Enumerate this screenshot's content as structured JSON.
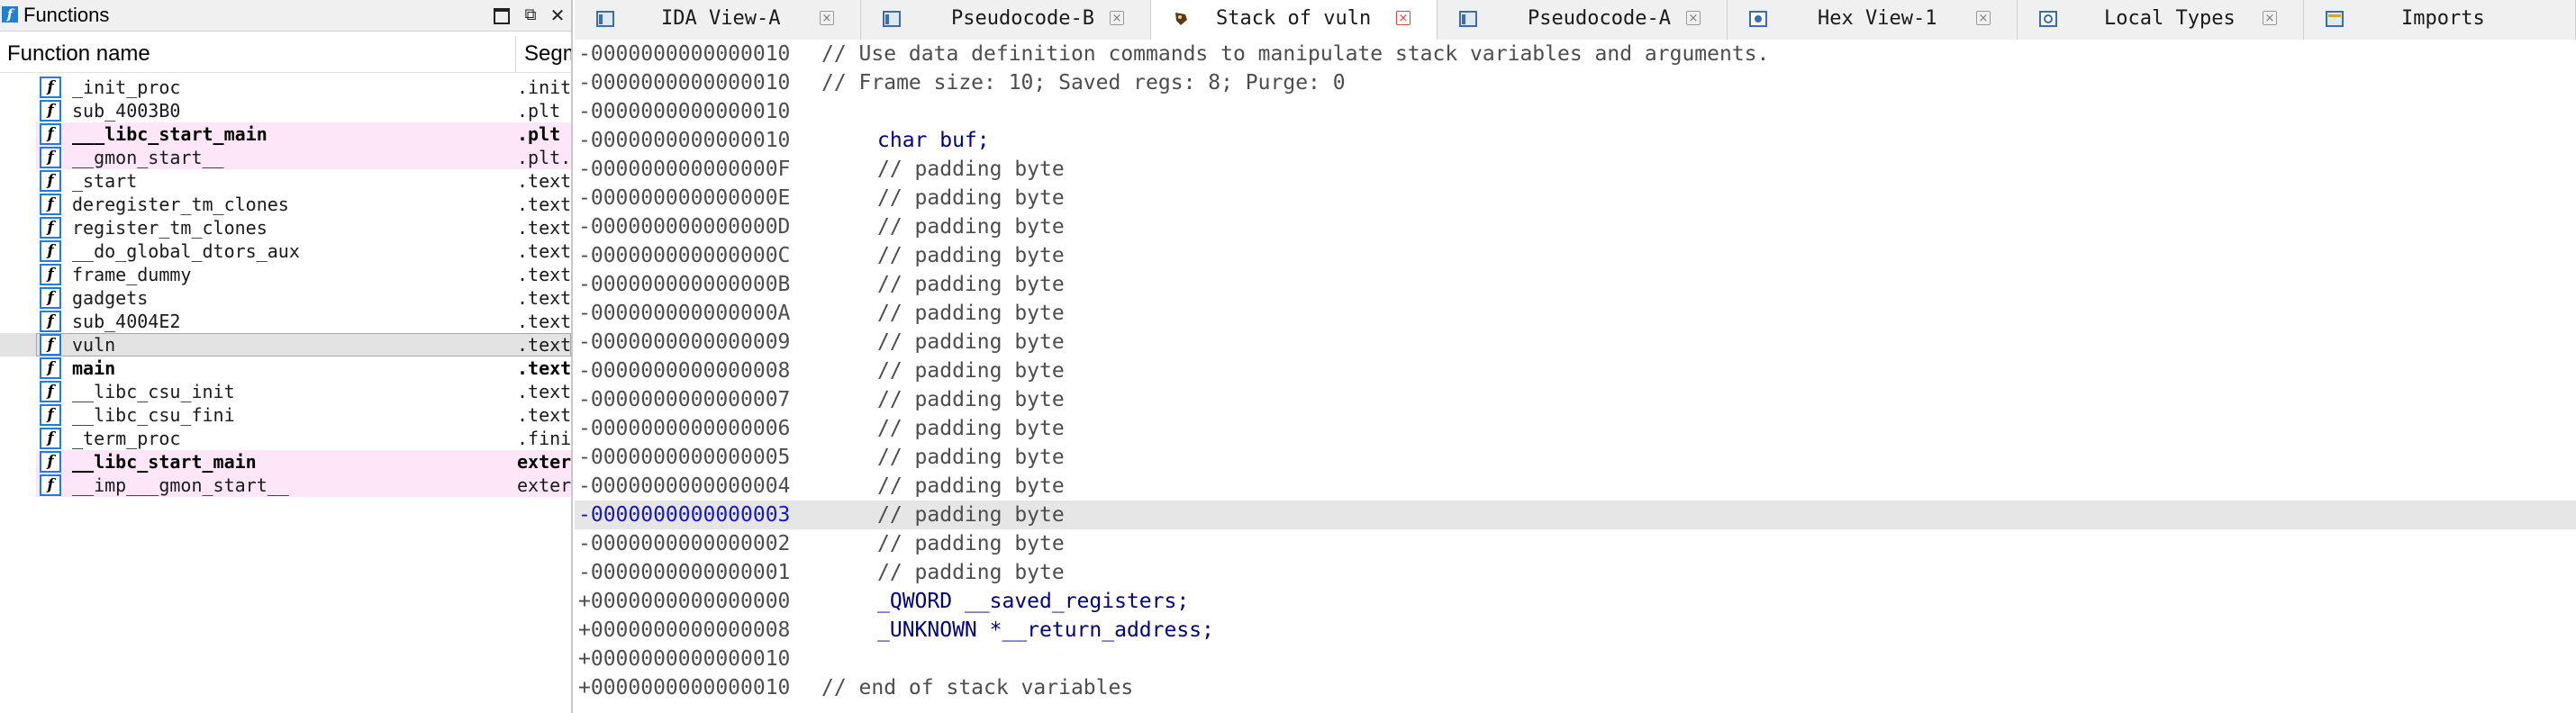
{
  "functions_panel": {
    "title": "Functions",
    "buttons": {
      "maximize": "□",
      "restore": "⧉",
      "close": "✕"
    },
    "columns": {
      "name": "Function name",
      "segment": "Segment"
    },
    "functions": [
      {
        "name": "_init_proc",
        "segment": ".init",
        "style": "normal"
      },
      {
        "name": "sub_4003B0",
        "segment": ".plt",
        "style": "normal"
      },
      {
        "name": "___libc_start_main",
        "segment": ".plt",
        "style": "pink-bold"
      },
      {
        "name": "__gmon_start__",
        "segment": ".plt.got",
        "style": "pink"
      },
      {
        "name": "_start",
        "segment": ".text",
        "style": "normal"
      },
      {
        "name": "deregister_tm_clones",
        "segment": ".text",
        "style": "normal"
      },
      {
        "name": "register_tm_clones",
        "segment": ".text",
        "style": "normal"
      },
      {
        "name": "__do_global_dtors_aux",
        "segment": ".text",
        "style": "normal"
      },
      {
        "name": "frame_dummy",
        "segment": ".text",
        "style": "normal"
      },
      {
        "name": "gadgets",
        "segment": ".text",
        "style": "normal"
      },
      {
        "name": "sub_4004E2",
        "segment": ".text",
        "style": "normal"
      },
      {
        "name": "vuln",
        "segment": ".text",
        "style": "selected"
      },
      {
        "name": "main",
        "segment": ".text",
        "style": "bold"
      },
      {
        "name": "__libc_csu_init",
        "segment": ".text",
        "style": "normal"
      },
      {
        "name": "__libc_csu_fini",
        "segment": ".text",
        "style": "normal"
      },
      {
        "name": "_term_proc",
        "segment": ".fini",
        "style": "normal"
      },
      {
        "name": "__libc_start_main",
        "segment": "extern",
        "style": "pink-bold"
      },
      {
        "name": "__imp___gmon_start__",
        "segment": "extern",
        "style": "pink"
      }
    ]
  },
  "tabs": [
    {
      "label": "IDA View-A",
      "icon": "ida-view-icon",
      "active": false
    },
    {
      "label": "Pseudocode-B",
      "icon": "pseudocode-icon",
      "active": false
    },
    {
      "label": "Stack of vuln",
      "icon": "stack-icon",
      "active": true
    },
    {
      "label": "Pseudocode-A",
      "icon": "pseudocode-icon",
      "active": false
    },
    {
      "label": "Hex View-1",
      "icon": "hex-view-icon",
      "active": false
    },
    {
      "label": "Local Types",
      "icon": "local-types-icon",
      "active": false
    },
    {
      "label": "Imports",
      "icon": "imports-icon",
      "active": false
    }
  ],
  "stack_view": {
    "lines": [
      {
        "offset": "-0000000000000010",
        "comment": "// Use data definition commands to manipulate stack variables and arguments."
      },
      {
        "offset": "-0000000000000010",
        "comment": "// Frame size: 10; Saved regs: 8; Purge: 0"
      },
      {
        "offset": "-0000000000000010"
      },
      {
        "offset": "-0000000000000010",
        "content": "char buf;",
        "kind": "decl"
      },
      {
        "offset": "-000000000000000F",
        "content": "// padding byte",
        "kind": "pad"
      },
      {
        "offset": "-000000000000000E",
        "content": "// padding byte",
        "kind": "pad"
      },
      {
        "offset": "-000000000000000D",
        "content": "// padding byte",
        "kind": "pad"
      },
      {
        "offset": "-000000000000000C",
        "content": "// padding byte",
        "kind": "pad"
      },
      {
        "offset": "-000000000000000B",
        "content": "// padding byte",
        "kind": "pad"
      },
      {
        "offset": "-000000000000000A",
        "content": "// padding byte",
        "kind": "pad"
      },
      {
        "offset": "-0000000000000009",
        "content": "// padding byte",
        "kind": "pad"
      },
      {
        "offset": "-0000000000000008",
        "content": "// padding byte",
        "kind": "pad"
      },
      {
        "offset": "-0000000000000007",
        "content": "// padding byte",
        "kind": "pad"
      },
      {
        "offset": "-0000000000000006",
        "content": "// padding byte",
        "kind": "pad"
      },
      {
        "offset": "-0000000000000005",
        "content": "// padding byte",
        "kind": "pad"
      },
      {
        "offset": "-0000000000000004",
        "content": "// padding byte",
        "kind": "pad"
      },
      {
        "offset": "-0000000000000003",
        "content": "// padding byte",
        "kind": "pad",
        "highlighted": true
      },
      {
        "offset": "-0000000000000002",
        "content": "// padding byte",
        "kind": "pad"
      },
      {
        "offset": "-0000000000000001",
        "content": "// padding byte",
        "kind": "pad"
      },
      {
        "offset": "+0000000000000000",
        "content": "_QWORD __saved_registers;",
        "kind": "decl"
      },
      {
        "offset": "+0000000000000008",
        "content": "_UNKNOWN *__return_address;",
        "kind": "decl"
      },
      {
        "offset": "+0000000000000010"
      },
      {
        "offset": "+0000000000000010",
        "comment": "// end of stack variables"
      }
    ]
  },
  "colors": {
    "function_icon_border": "#1f7fd6",
    "library_function_bg": "#fde6f8",
    "declaration_text": "#000080",
    "highlight_offset": "#1818c0",
    "active_tab_close": "#d04848"
  }
}
